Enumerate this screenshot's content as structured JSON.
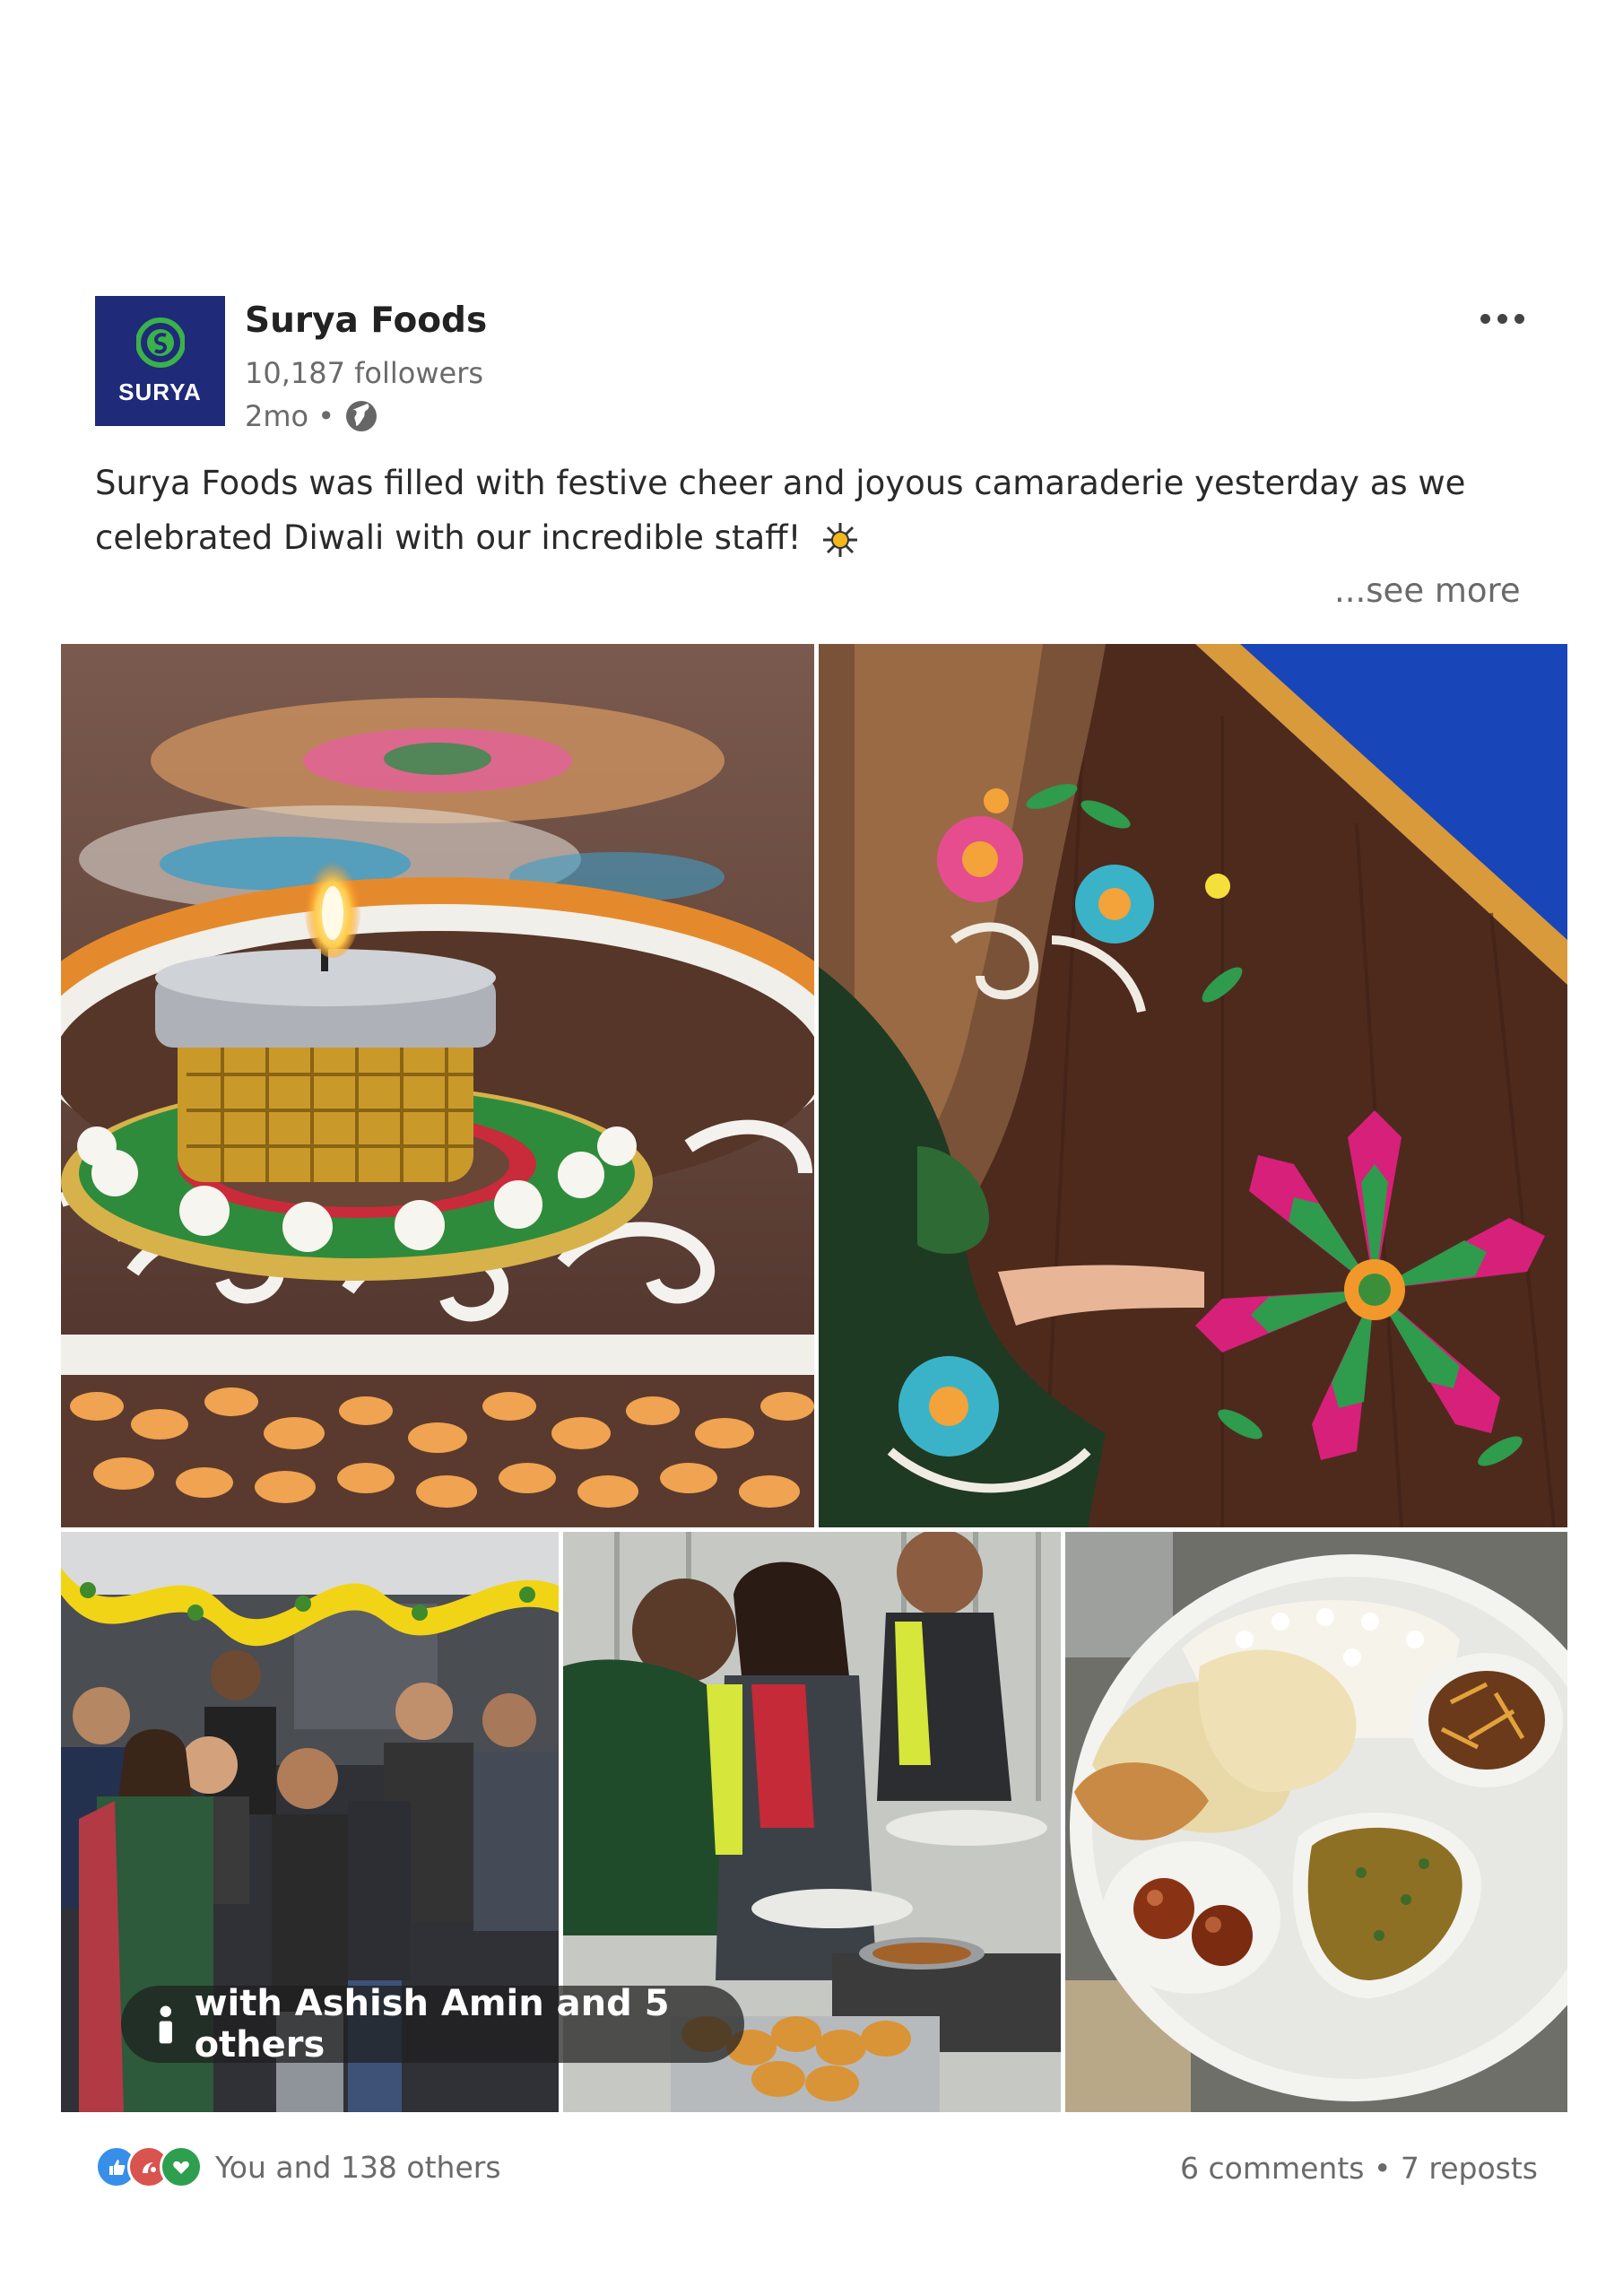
{
  "post": {
    "author": "Surya Foods",
    "logo_text": "SURYA",
    "followers": "10,187 followers",
    "time": "2mo •",
    "caption": "Surya Foods was filled with festive cheer and joyous camaraderie yesterday as we celebrated Diwali with our incredible staff!",
    "see_more": "...see more",
    "tag_label": "with Ashish Amin and 5 others",
    "reactions_text": "You and 138 others",
    "counts_text": "6 comments • 7 reposts"
  },
  "colors": {
    "logo_bg": "#1f2a78",
    "like": "#378fe9",
    "celebrate": "#d9534f",
    "support": "#2e9e4f"
  }
}
